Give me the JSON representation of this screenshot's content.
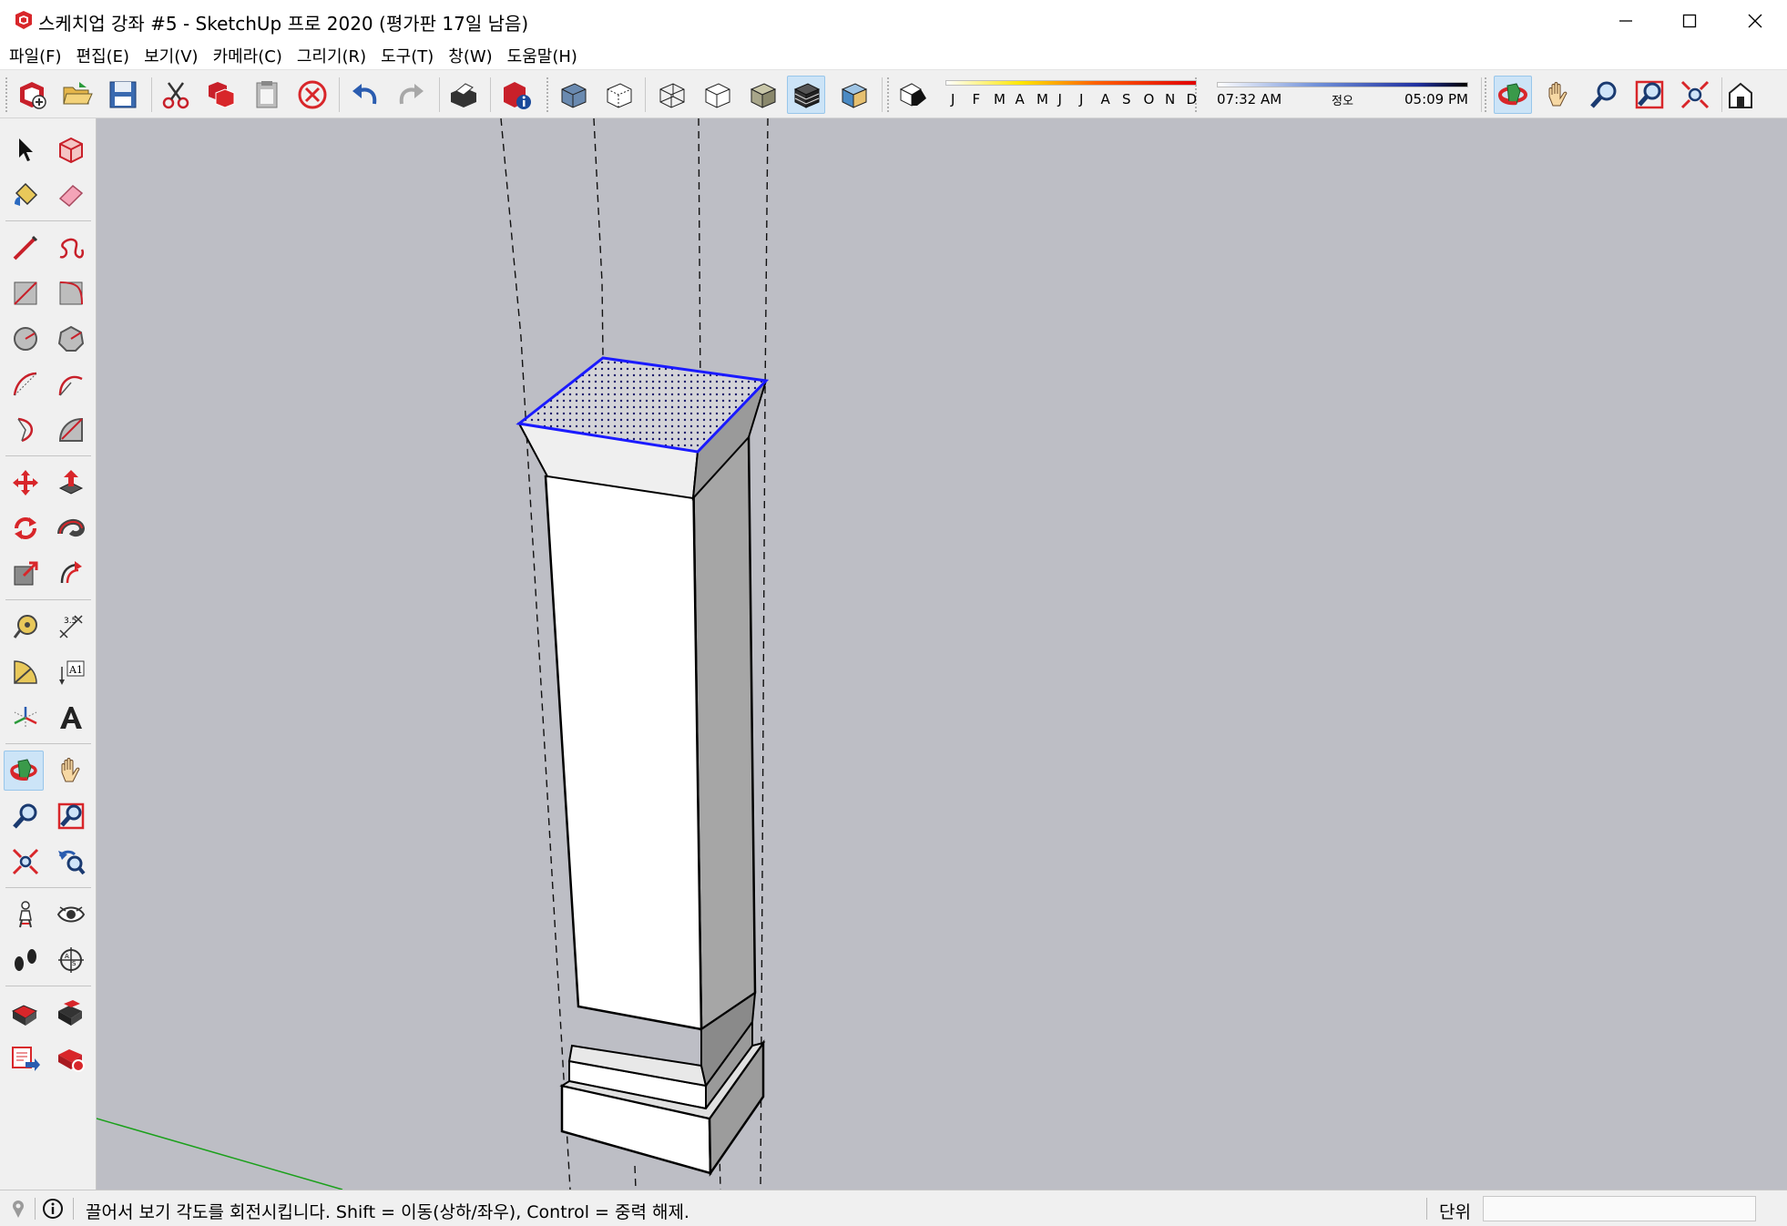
{
  "window": {
    "title": "스케치업 강좌 #5 - SketchUp 프로 2020 (평가판 17일 남음)",
    "controls": [
      "minimize-icon",
      "maximize-icon",
      "close-icon"
    ]
  },
  "menu": [
    "파일(F)",
    "편집(E)",
    "보기(V)",
    "카메라(C)",
    "그리기(R)",
    "도구(T)",
    "창(W)",
    "도움말(H)"
  ],
  "toolbar": {
    "icons": [
      "new-file-icon",
      "open-icon",
      "save-icon",
      "cut-icon",
      "copy-icon",
      "paste-icon",
      "delete-icon",
      "undo-icon",
      "redo-icon",
      "print-icon",
      "model-info-icon",
      "xray-icon",
      "back-edges-icon",
      "wireframe-icon",
      "hidden-line-icon",
      "shaded-icon",
      "shaded-textures-icon",
      "monochrome-icon",
      "shadows-icon",
      "orbit-icon",
      "pan-icon",
      "zoom-icon",
      "zoom-window-icon",
      "zoom-extents-icon",
      "warehouse-icon"
    ],
    "active": "shaded-textures-icon",
    "shadow_months": [
      "J",
      "F",
      "M",
      "A",
      "M",
      "J",
      "J",
      "A",
      "S",
      "O",
      "N",
      "D"
    ],
    "time_start": "07:32 AM",
    "time_mid": "정오",
    "time_end": "05:09 PM"
  },
  "palette": {
    "tools": [
      "select-icon",
      "make-component-icon",
      "paint-bucket-icon",
      "eraser-icon",
      "line-icon",
      "freehand-icon",
      "rectangle-icon",
      "rotated-rectangle-icon",
      "circle-icon",
      "polygon-icon",
      "arc-icon",
      "two-point-arc-icon",
      "three-point-arc-icon",
      "pie-icon",
      "move-icon",
      "push-pull-icon",
      "rotate-icon",
      "follow-me-icon",
      "scale-icon",
      "offset-icon",
      "tape-measure-icon",
      "dimension-icon",
      "protractor-icon",
      "text-icon",
      "axes-icon",
      "3d-text-icon",
      "orbit-icon",
      "pan-icon",
      "zoom-icon",
      "zoom-window-icon",
      "zoom-extents-icon",
      "previous-view-icon",
      "position-camera-icon",
      "look-around-icon",
      "walk-icon",
      "section-plane-icon",
      "warehouse-icon",
      "extension-warehouse-icon",
      "send-to-layout-icon",
      "extension-manager-icon"
    ],
    "active": "orbit-icon"
  },
  "status": {
    "message": "끌어서 보기 각도를 회전시킵니다. Shift = 이동(상하/좌우), Control = 중력 해제.",
    "measure_label": "단위",
    "measure_value": ""
  },
  "colors": {
    "viewport_bg": "#bdbec5",
    "selection_blue": "#1a1aff",
    "green_axis": "#1aa01a",
    "active_tool": "#cce4f7"
  }
}
